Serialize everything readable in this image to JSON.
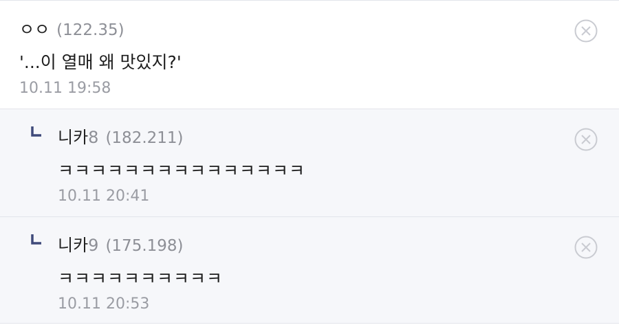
{
  "comments": [
    {
      "nickname": "ㅇㅇ",
      "nickname_suffix": "",
      "ip": "(122.35)",
      "text": "'...이 열매 왜 맛있지?'",
      "date": "10.11 19:58",
      "delete_icon": "close-circle-icon"
    },
    {
      "nickname": "니카",
      "nickname_suffix": "8",
      "ip": "(182.211)",
      "text": "ㅋㅋㅋㅋㅋㅋㅋㅋㅋㅋㅋㅋㅋㅋㅋ",
      "date": "10.11 20:41",
      "delete_icon": "close-circle-icon"
    },
    {
      "nickname": "니카",
      "nickname_suffix": "9",
      "ip": "(175.198)",
      "text": "ㅋㅋㅋㅋㅋㅋㅋㅋㅋㅋ",
      "date": "10.11 20:53",
      "delete_icon": "close-circle-icon"
    }
  ],
  "colors": {
    "reply_mark": "#3f4a7a",
    "reply_background": "#f6f7fa",
    "meta_text": "#8d8f96",
    "divider": "#e2e4ea"
  }
}
